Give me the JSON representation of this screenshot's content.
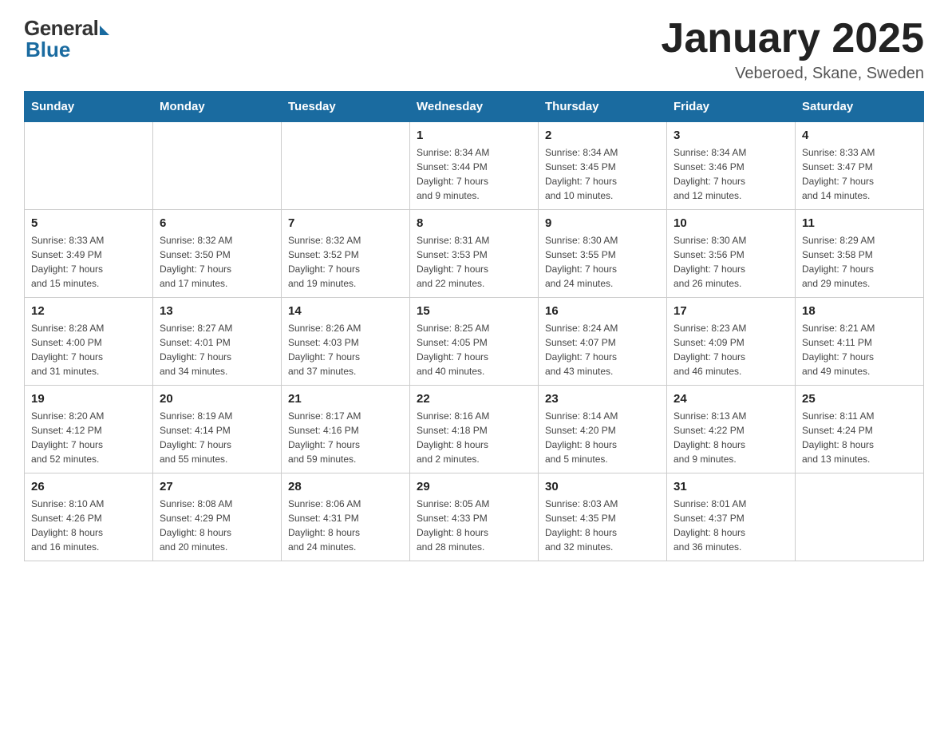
{
  "header": {
    "logo_general": "General",
    "logo_blue": "Blue",
    "month_title": "January 2025",
    "location": "Veberoed, Skane, Sweden"
  },
  "weekdays": [
    "Sunday",
    "Monday",
    "Tuesday",
    "Wednesday",
    "Thursday",
    "Friday",
    "Saturday"
  ],
  "weeks": [
    [
      {
        "day": "",
        "info": ""
      },
      {
        "day": "",
        "info": ""
      },
      {
        "day": "",
        "info": ""
      },
      {
        "day": "1",
        "info": "Sunrise: 8:34 AM\nSunset: 3:44 PM\nDaylight: 7 hours\nand 9 minutes."
      },
      {
        "day": "2",
        "info": "Sunrise: 8:34 AM\nSunset: 3:45 PM\nDaylight: 7 hours\nand 10 minutes."
      },
      {
        "day": "3",
        "info": "Sunrise: 8:34 AM\nSunset: 3:46 PM\nDaylight: 7 hours\nand 12 minutes."
      },
      {
        "day": "4",
        "info": "Sunrise: 8:33 AM\nSunset: 3:47 PM\nDaylight: 7 hours\nand 14 minutes."
      }
    ],
    [
      {
        "day": "5",
        "info": "Sunrise: 8:33 AM\nSunset: 3:49 PM\nDaylight: 7 hours\nand 15 minutes."
      },
      {
        "day": "6",
        "info": "Sunrise: 8:32 AM\nSunset: 3:50 PM\nDaylight: 7 hours\nand 17 minutes."
      },
      {
        "day": "7",
        "info": "Sunrise: 8:32 AM\nSunset: 3:52 PM\nDaylight: 7 hours\nand 19 minutes."
      },
      {
        "day": "8",
        "info": "Sunrise: 8:31 AM\nSunset: 3:53 PM\nDaylight: 7 hours\nand 22 minutes."
      },
      {
        "day": "9",
        "info": "Sunrise: 8:30 AM\nSunset: 3:55 PM\nDaylight: 7 hours\nand 24 minutes."
      },
      {
        "day": "10",
        "info": "Sunrise: 8:30 AM\nSunset: 3:56 PM\nDaylight: 7 hours\nand 26 minutes."
      },
      {
        "day": "11",
        "info": "Sunrise: 8:29 AM\nSunset: 3:58 PM\nDaylight: 7 hours\nand 29 minutes."
      }
    ],
    [
      {
        "day": "12",
        "info": "Sunrise: 8:28 AM\nSunset: 4:00 PM\nDaylight: 7 hours\nand 31 minutes."
      },
      {
        "day": "13",
        "info": "Sunrise: 8:27 AM\nSunset: 4:01 PM\nDaylight: 7 hours\nand 34 minutes."
      },
      {
        "day": "14",
        "info": "Sunrise: 8:26 AM\nSunset: 4:03 PM\nDaylight: 7 hours\nand 37 minutes."
      },
      {
        "day": "15",
        "info": "Sunrise: 8:25 AM\nSunset: 4:05 PM\nDaylight: 7 hours\nand 40 minutes."
      },
      {
        "day": "16",
        "info": "Sunrise: 8:24 AM\nSunset: 4:07 PM\nDaylight: 7 hours\nand 43 minutes."
      },
      {
        "day": "17",
        "info": "Sunrise: 8:23 AM\nSunset: 4:09 PM\nDaylight: 7 hours\nand 46 minutes."
      },
      {
        "day": "18",
        "info": "Sunrise: 8:21 AM\nSunset: 4:11 PM\nDaylight: 7 hours\nand 49 minutes."
      }
    ],
    [
      {
        "day": "19",
        "info": "Sunrise: 8:20 AM\nSunset: 4:12 PM\nDaylight: 7 hours\nand 52 minutes."
      },
      {
        "day": "20",
        "info": "Sunrise: 8:19 AM\nSunset: 4:14 PM\nDaylight: 7 hours\nand 55 minutes."
      },
      {
        "day": "21",
        "info": "Sunrise: 8:17 AM\nSunset: 4:16 PM\nDaylight: 7 hours\nand 59 minutes."
      },
      {
        "day": "22",
        "info": "Sunrise: 8:16 AM\nSunset: 4:18 PM\nDaylight: 8 hours\nand 2 minutes."
      },
      {
        "day": "23",
        "info": "Sunrise: 8:14 AM\nSunset: 4:20 PM\nDaylight: 8 hours\nand 5 minutes."
      },
      {
        "day": "24",
        "info": "Sunrise: 8:13 AM\nSunset: 4:22 PM\nDaylight: 8 hours\nand 9 minutes."
      },
      {
        "day": "25",
        "info": "Sunrise: 8:11 AM\nSunset: 4:24 PM\nDaylight: 8 hours\nand 13 minutes."
      }
    ],
    [
      {
        "day": "26",
        "info": "Sunrise: 8:10 AM\nSunset: 4:26 PM\nDaylight: 8 hours\nand 16 minutes."
      },
      {
        "day": "27",
        "info": "Sunrise: 8:08 AM\nSunset: 4:29 PM\nDaylight: 8 hours\nand 20 minutes."
      },
      {
        "day": "28",
        "info": "Sunrise: 8:06 AM\nSunset: 4:31 PM\nDaylight: 8 hours\nand 24 minutes."
      },
      {
        "day": "29",
        "info": "Sunrise: 8:05 AM\nSunset: 4:33 PM\nDaylight: 8 hours\nand 28 minutes."
      },
      {
        "day": "30",
        "info": "Sunrise: 8:03 AM\nSunset: 4:35 PM\nDaylight: 8 hours\nand 32 minutes."
      },
      {
        "day": "31",
        "info": "Sunrise: 8:01 AM\nSunset: 4:37 PM\nDaylight: 8 hours\nand 36 minutes."
      },
      {
        "day": "",
        "info": ""
      }
    ]
  ]
}
